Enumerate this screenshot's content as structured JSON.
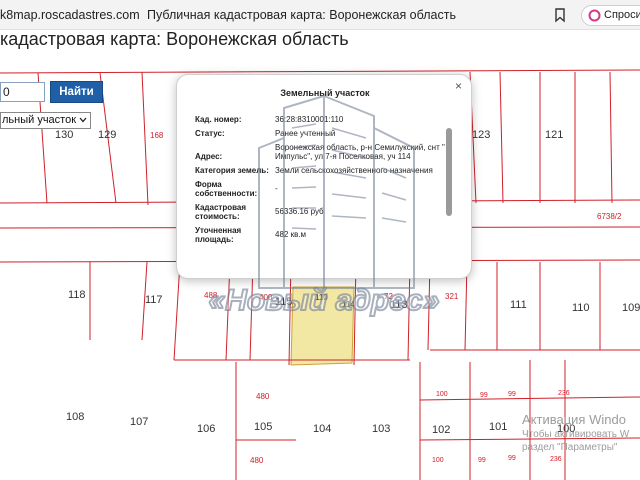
{
  "browser": {
    "url": "k8map.roscadastres.com",
    "tab_title": "Публичная кадастровая карта: Воронежская область",
    "ask_label": "Спросить"
  },
  "page": {
    "title": "кадастровая карта: Воронежская область"
  },
  "search": {
    "input_value": "0",
    "button_label": "Найти",
    "type_selected": "льный участок"
  },
  "map": {
    "parcel_labels": [
      "129",
      "130",
      "168",
      "123",
      "121",
      "6738/2",
      "118",
      "117",
      "488",
      "400",
      "115",
      "110",
      "72",
      "321",
      "111",
      "110",
      "109",
      "114",
      "113",
      "480",
      "107",
      "108",
      "106",
      "105",
      "104",
      "103",
      "102",
      "101",
      "100",
      "99",
      "99",
      "236",
      "480",
      "100",
      "99",
      "99",
      "236",
      "100"
    ]
  },
  "popup": {
    "title": "Земельный участок",
    "close_label": "×",
    "rows": [
      {
        "label": "Кад. номер:",
        "value": "36:28:8310001:110"
      },
      {
        "label": "Статус:",
        "value": "Ранее учтенный"
      },
      {
        "label": "Адрес:",
        "value": "Воронежская область, р-н Семилукский, снт \" Импульс\", ул 7-я Поселковая, уч 114"
      },
      {
        "label": "Категория земель:",
        "value": "Земли сельскохозяйственного назначения"
      },
      {
        "label": "Форма собственности:",
        "value": "-"
      },
      {
        "label": "Кадастровая стоимость:",
        "value": "56336.16 руб"
      },
      {
        "label": "Уточненная площадь:",
        "value": "482 кв.м"
      }
    ]
  },
  "watermark": {
    "text": "«Новый адрес»"
  },
  "activation": {
    "title": "Активация Windo",
    "line1": "Чтобы активировать W",
    "line2": "раздел \"Параметры\""
  },
  "colors": {
    "parcel_border": "#d0202a",
    "highlight_fill": "#f3e7a4",
    "button_blue": "#1f5fa8",
    "watermark": "#6e7c92"
  }
}
